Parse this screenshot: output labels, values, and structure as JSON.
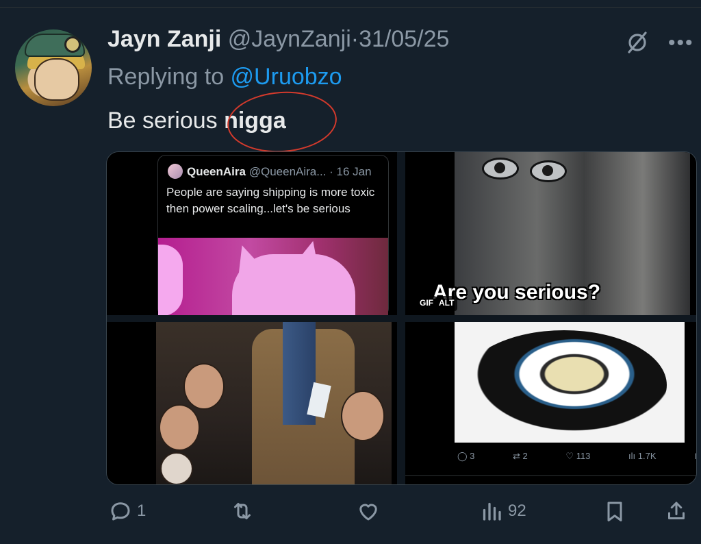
{
  "tweet": {
    "author_name": "Jayn Zanji",
    "author_handle": "@JaynZanji",
    "separator": "·",
    "date": "31/05/25",
    "reply_prefix": "Replying to ",
    "reply_handle": "@Uruobzo",
    "text_plain": "Be serious ",
    "text_bold": "nigga"
  },
  "media": {
    "quoted": {
      "name": "QueenAira",
      "handle": "@QueenAira...",
      "date": "· 16 Jan",
      "text": "People are saying shipping is more toxic then power scaling...let's be serious"
    },
    "gif_caption": "Are you serious?",
    "gif_badge": "GIF",
    "alt_badge": "ALT",
    "inner_stats": {
      "replies": "3",
      "reposts": "2",
      "likes": "113",
      "views": "1.7K"
    }
  },
  "actions": {
    "replies": "1",
    "retweets": "",
    "likes": "",
    "views": "92"
  },
  "icons": {
    "grok": "grok-icon",
    "more": "more-icon",
    "reply": "reply-icon",
    "retweet": "retweet-icon",
    "like": "heart-icon",
    "views": "views-icon",
    "bookmark": "bookmark-icon",
    "share": "share-icon"
  },
  "colors": {
    "background": "#15202b",
    "link": "#1d9bf0",
    "muted": "#8b98a5",
    "annotation": "#d43a2c"
  }
}
